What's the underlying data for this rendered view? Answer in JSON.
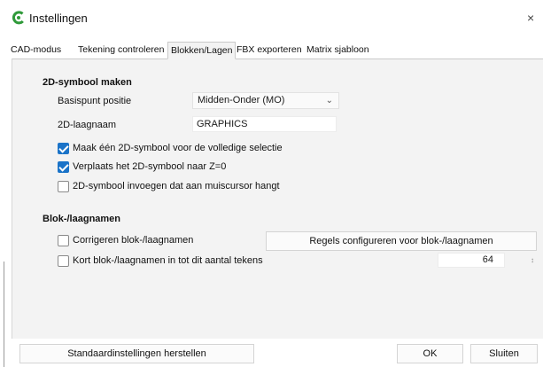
{
  "window": {
    "title": "Instellingen",
    "app_icon": "green-c-logo-icon",
    "close_icon": "close-icon",
    "close_glyph": "×",
    "accent_color": "#1a73c8",
    "logo_color": "#2f9a3a"
  },
  "tabs": [
    {
      "label": "CAD-modus",
      "active": false
    },
    {
      "label": "Tekening controleren",
      "active": false
    },
    {
      "label": "Blokken/Lagen",
      "active": true
    },
    {
      "label": "FBX exporteren",
      "active": false
    },
    {
      "label": "Matrix sjabloon",
      "active": false
    }
  ],
  "symbol_section": {
    "title": "2D-symbool maken",
    "basepoint_label": "Basispunt positie",
    "basepoint_value": "Midden-Onder (MO)",
    "layer_label": "2D-laagnaam",
    "layer_value": "GRAPHICS",
    "options": [
      {
        "label": "Maak één 2D-symbool voor de volledige selectie",
        "checked": true
      },
      {
        "label": "Verplaats het 2D-symbool naar Z=0",
        "checked": true
      },
      {
        "label": "2D-symbool invoegen dat aan muiscursor hangt",
        "checked": false
      }
    ]
  },
  "names_section": {
    "title": "Blok-/laagnamen",
    "correct_label": "Corrigeren blok-/laagnamen",
    "correct_checked": false,
    "rules_button": "Regels configureren voor blok-/laagnamen",
    "truncate_label": "Kort blok-/laagnamen in tot dit aantal tekens",
    "truncate_checked": false,
    "truncate_value": "64"
  },
  "footer": {
    "reset_button": "Standaardinstellingen herstellen",
    "ok_button": "OK",
    "close_button": "Sluiten"
  }
}
